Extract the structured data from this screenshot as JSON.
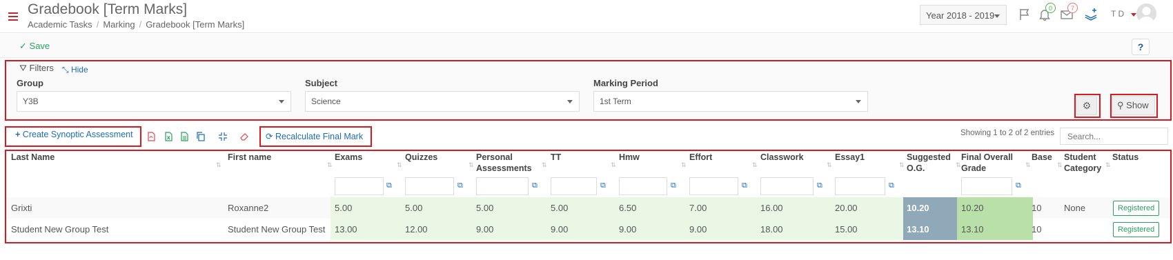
{
  "header": {
    "title": "Gradebook [Term Marks]",
    "breadcrumb": [
      "Academic Tasks",
      "Marking",
      "Gradebook [Term Marks]"
    ],
    "year": "Year 2018 - 2019",
    "notifications_count": "0",
    "messages_count": "7",
    "user_initials": "T D"
  },
  "toolbar": {
    "save_label": "Save",
    "help_label": "?"
  },
  "filters": {
    "title": "Filters",
    "hide_label": "Hide",
    "group_label": "Group",
    "group_value": "Y3B",
    "subject_label": "Subject",
    "subject_value": "Science",
    "period_label": "Marking Period",
    "period_value": "1st Term",
    "show_label": "Show"
  },
  "actions": {
    "synoptic_label": "Create Synoptic Assessment",
    "recalc_label": "Recalculate Final Mark",
    "showing_text": "Showing 1 to 2 of 2 entries",
    "search_placeholder": "Search..."
  },
  "table": {
    "columns": [
      "Last Name",
      "First name",
      "Exams",
      "Quizzes",
      "Personal Assessments",
      "TT",
      "Hmw",
      "Effort",
      "Classwork",
      "Essay1",
      "Suggested O.G.",
      "Final Overall Grade",
      "Base",
      "Student Category",
      "Status"
    ],
    "rows": [
      [
        "Grixti",
        "Roxanne2",
        "5.00",
        "5.00",
        "5.00",
        "5.00",
        "6.50",
        "7.00",
        "16.00",
        "20.00",
        "10.20",
        "10.20",
        "10",
        "None",
        "Registered"
      ],
      [
        "Student New Group Test",
        "Student New Group Test",
        "13.00",
        "12.00",
        "9.00",
        "9.00",
        "9.00",
        "9.00",
        "18.00",
        "15.00",
        "13.10",
        "13.10",
        "10",
        "",
        "Registered"
      ]
    ]
  },
  "colors": {
    "accent": "#d9191d",
    "link": "#1e6bb8",
    "success": "#27a15e",
    "suggested": "#8fa9b8",
    "final": "#b8e0a8",
    "marks": "#eaf7e4"
  }
}
